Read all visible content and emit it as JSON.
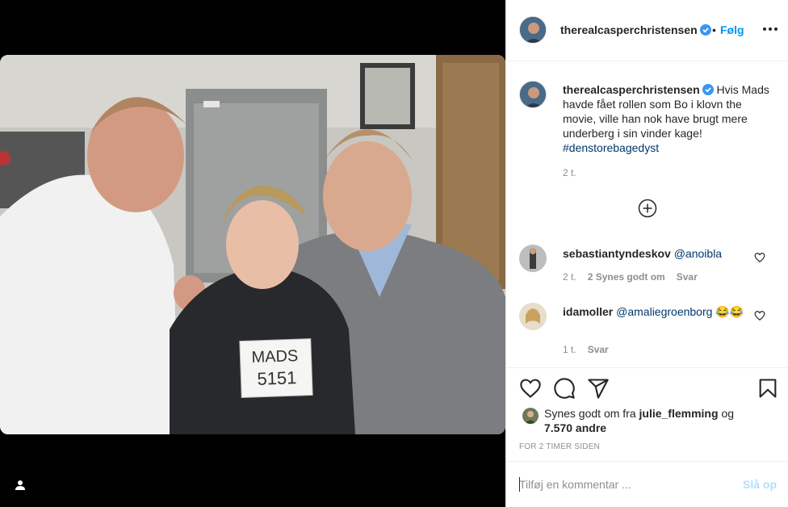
{
  "post": {
    "username": "therealcasperchristensen",
    "dot": "•",
    "follow_label": "Følg",
    "more_icon": "more-horizontal-icon",
    "caption": "Hvis Mads havde fået rollen som Bo i klovn the movie, ville han nok have brugt mere underberg i sin vinder kage!",
    "hashtag": "#denstorebagedyst",
    "caption_time": "2 t.",
    "sign_text": [
      "MADS",
      "5151"
    ]
  },
  "comments": [
    {
      "username": "sebastiantyndeskov",
      "text": "@anoibla",
      "time": "2 t.",
      "likes": "2 Synes godt om",
      "reply": "Svar"
    },
    {
      "username": "idamoller",
      "text": "@amaliegroenborg 😂😂",
      "time": "1 t.",
      "reply": "Svar"
    }
  ],
  "actions": {
    "like_icon": "heart-icon",
    "comment_icon": "comment-icon",
    "share_icon": "share-icon",
    "save_icon": "bookmark-icon",
    "likes_prefix": "Synes godt om fra",
    "likes_user": "julie_flemming",
    "likes_and": "og",
    "likes_count": "7.570 andre",
    "since": "For 2 timer siden"
  },
  "add_comment": {
    "placeholder": "Tilføj en kommentar ...",
    "post_label": "Slå op"
  },
  "colors": {
    "accent": "#0095f6",
    "link": "#00376b",
    "muted": "#8e8e8e",
    "verified": "#3897f0"
  }
}
